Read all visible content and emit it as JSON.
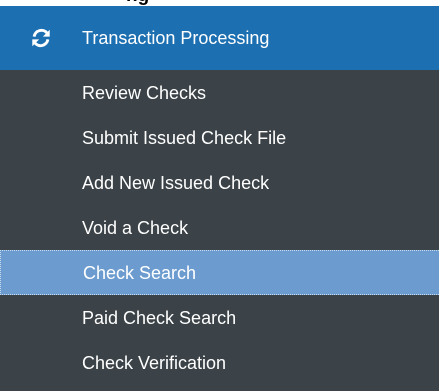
{
  "page": {
    "clipped_heading": "ng"
  },
  "menu": {
    "header": {
      "icon": "refresh-icon",
      "label": "Transaction Processing"
    },
    "items": [
      {
        "label": "Review Checks",
        "active": false
      },
      {
        "label": "Submit Issued Check File",
        "active": false
      },
      {
        "label": "Add New Issued Check",
        "active": false
      },
      {
        "label": "Void a Check",
        "active": false
      },
      {
        "label": "Check Search",
        "active": true
      },
      {
        "label": "Paid Check Search",
        "active": false
      },
      {
        "label": "Check Verification",
        "active": false
      }
    ]
  },
  "colors": {
    "menu_background": "#3b4348",
    "header_background": "#1c6fb1",
    "active_item_background": "#6c9ccf",
    "text": "#ffffff"
  }
}
